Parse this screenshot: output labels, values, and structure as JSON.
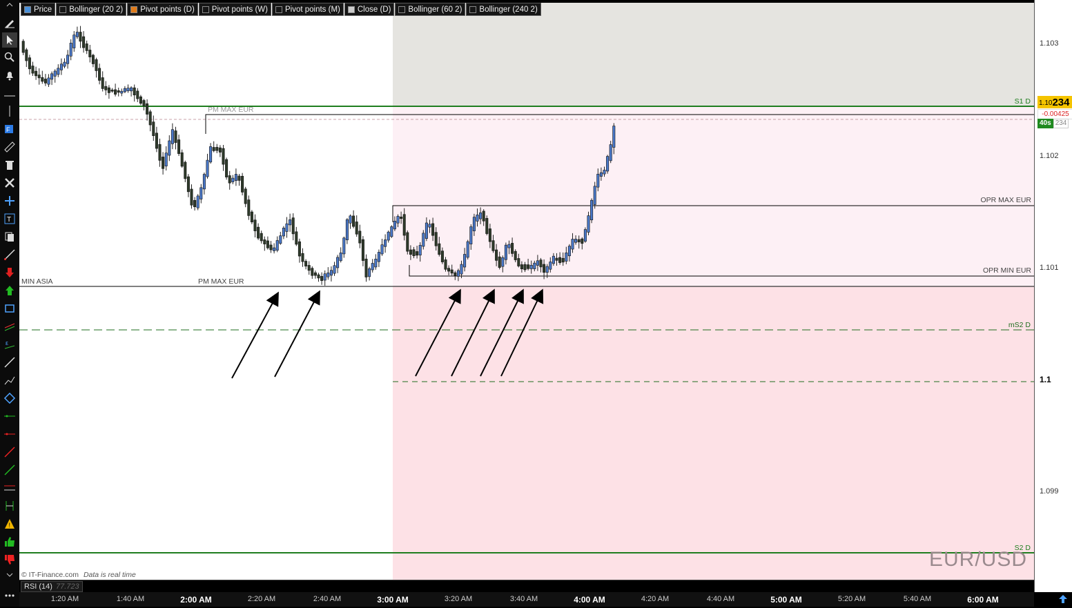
{
  "legend": [
    {
      "label": "Price",
      "color": "#4a90d9"
    },
    {
      "label": "Bollinger (20 2)",
      "color": "#888888"
    },
    {
      "label": "Pivot points (D)",
      "color": "#e07b1a"
    },
    {
      "label": "Pivot points (W)",
      "color": "#888888"
    },
    {
      "label": "Pivot points (M)",
      "color": "#888888"
    },
    {
      "label": "Close (D)",
      "color": "#cccccc"
    },
    {
      "label": "Bollinger (60 2)",
      "color": "#888888"
    },
    {
      "label": "Bollinger (240 2)",
      "color": "#888888"
    }
  ],
  "price_axis": {
    "ticks": [
      "1.103",
      "1.102",
      "1.101",
      "1.1",
      "1.099"
    ],
    "current_price": "1.10234",
    "current_price_big": "234",
    "current_price_small": "1.10",
    "change": "-0.00425",
    "timer": "40s",
    "timer_value": "234"
  },
  "time_axis": {
    "ticks": [
      {
        "label": "1:20 AM",
        "bold": false
      },
      {
        "label": "1:40 AM",
        "bold": false
      },
      {
        "label": "2:00 AM",
        "bold": true
      },
      {
        "label": "2:20 AM",
        "bold": false
      },
      {
        "label": "2:40 AM",
        "bold": false
      },
      {
        "label": "3:00 AM",
        "bold": true
      },
      {
        "label": "3:20 AM",
        "bold": false
      },
      {
        "label": "3:40 AM",
        "bold": false
      },
      {
        "label": "4:00 AM",
        "bold": true
      },
      {
        "label": "4:20 AM",
        "bold": false
      },
      {
        "label": "4:40 AM",
        "bold": false
      },
      {
        "label": "5:00 AM",
        "bold": true
      },
      {
        "label": "5:20 AM",
        "bold": false
      },
      {
        "label": "5:40 AM",
        "bold": false
      },
      {
        "label": "6:00 AM",
        "bold": true
      }
    ]
  },
  "levels": {
    "s1": "S1 D",
    "pm_max_top": "PM MAX EUR",
    "opr_max": "OPR MAX EUR",
    "opr_min": "OPR MIN EUR",
    "min_asia": "MIN ASIA",
    "pm_max_bottom": "PM MAX EUR",
    "ms2": "mS2 D",
    "s2": "S2 D"
  },
  "symbol": "EUR/USD",
  "copyright": "© IT-Finance.com",
  "realtime_note": "Data is real time",
  "rsi": {
    "label": "RSI (14)",
    "value": "77.723"
  },
  "colors": {
    "bull": "#4a78c8",
    "bear": "#2e3a2a",
    "pivot_green": "#1e7d1e"
  }
}
